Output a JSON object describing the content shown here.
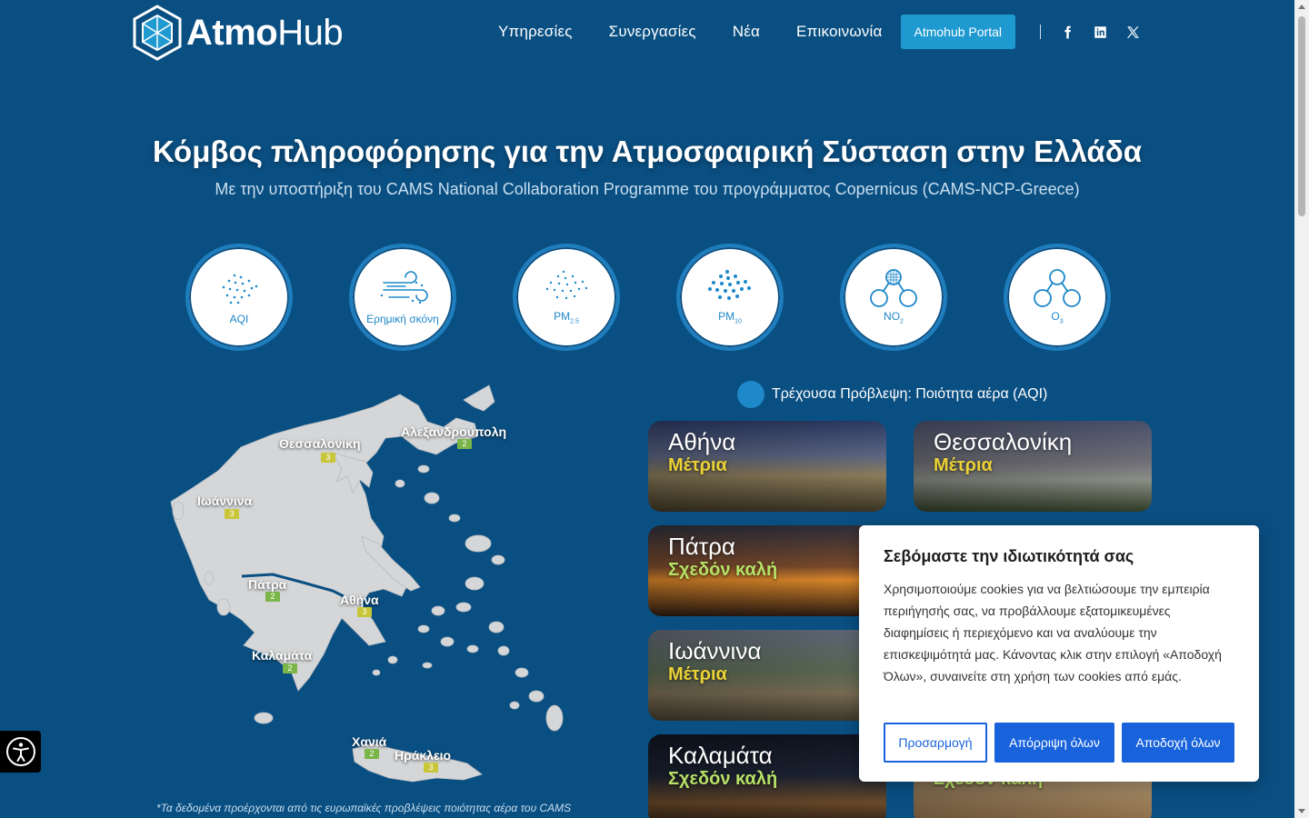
{
  "header": {
    "logo_bold": "Atmo",
    "logo_light": "Hub",
    "nav": [
      "Υπηρεσίες",
      "Συνεργασίες",
      "Νέα",
      "Επικοινωνία"
    ],
    "portal_label": "Atmohub Portal",
    "social_icons": [
      "facebook-icon",
      "linkedin-icon",
      "x-icon"
    ]
  },
  "hero": {
    "title": "Κόμβος πληροφόρησης για την Ατμοσφαιρική Σύσταση στην Ελλάδα",
    "subtitle": "Με την υποστήριξη του CAMS National Collaboration Programme του προγράμματος Copernicus (CAMS-NCP-Greece)"
  },
  "pollutants": [
    {
      "label": "AQI"
    },
    {
      "label": "Ερημική σκόνη"
    },
    {
      "label": "PM",
      "sub": "2.5"
    },
    {
      "label": "PM",
      "sub": "10"
    },
    {
      "label": "NO",
      "sub": "2"
    },
    {
      "label": "O",
      "sub": "3"
    }
  ],
  "map": {
    "cities": [
      {
        "name": "Θεσσαλονίκη",
        "value": "3",
        "level": "yellow"
      },
      {
        "name": "Αλεξανδρούπολη",
        "value": "2",
        "level": "green"
      },
      {
        "name": "Ιωάννινα",
        "value": "3",
        "level": "yellow"
      },
      {
        "name": "Πάτρα",
        "value": "2",
        "level": "green"
      },
      {
        "name": "Αθήνα",
        "value": "3",
        "level": "yellow"
      },
      {
        "name": "Καλαμάτα",
        "value": "2",
        "level": "green"
      },
      {
        "name": "Χανιά",
        "value": "2",
        "level": "green"
      },
      {
        "name": "Ηράκλειο",
        "value": "3",
        "level": "yellow"
      }
    ],
    "footnote": "*Τα δεδομένα προέρχονται από τις ευρωπαϊκές προβλέψεις ποιότητας αέρα του CAMS"
  },
  "forecast_label": "Τρέχουσα Πρόβλεψη: Ποιότητα αέρα (AQI)",
  "cards": [
    {
      "city": "Αθήνα",
      "status": "Μέτρια"
    },
    {
      "city": "Θεσσαλονίκη",
      "status": "Μέτρια"
    },
    {
      "city": "Πάτρα",
      "status": "Σχεδόν καλή"
    },
    {
      "city": "Ιωάννινα",
      "status": "Μέτρια"
    },
    {
      "city": "Καλαμάτα",
      "status": "Σχεδόν καλή"
    },
    {
      "city": "",
      "status": "Σχεδόν καλή"
    }
  ],
  "cookie": {
    "title": "Σεβόμαστε την ιδιωτικότητά σας",
    "body": "Χρησιμοποιούμε cookies για να βελτιώσουμε την εμπειρία περιήγησής σας, να προβάλλουμε εξατομικευμένες διαφημίσεις ή περιεχόμενο και να αναλύουμε την επισκεψιμότητά μας. Κάνοντας κλικ στην επιλογή «Αποδοχή Όλων», συναινείτε στη χρήση των cookies από εμάς.",
    "customize": "Προσαρμογή",
    "reject": "Απόρριψη όλων",
    "accept": "Αποδοχή όλων"
  },
  "colors": {
    "background": "#0a4f82",
    "accent": "#1f9ad1",
    "moderate": "#ebd136",
    "fair": "#b7e067",
    "cookie_button": "#1863dc"
  }
}
